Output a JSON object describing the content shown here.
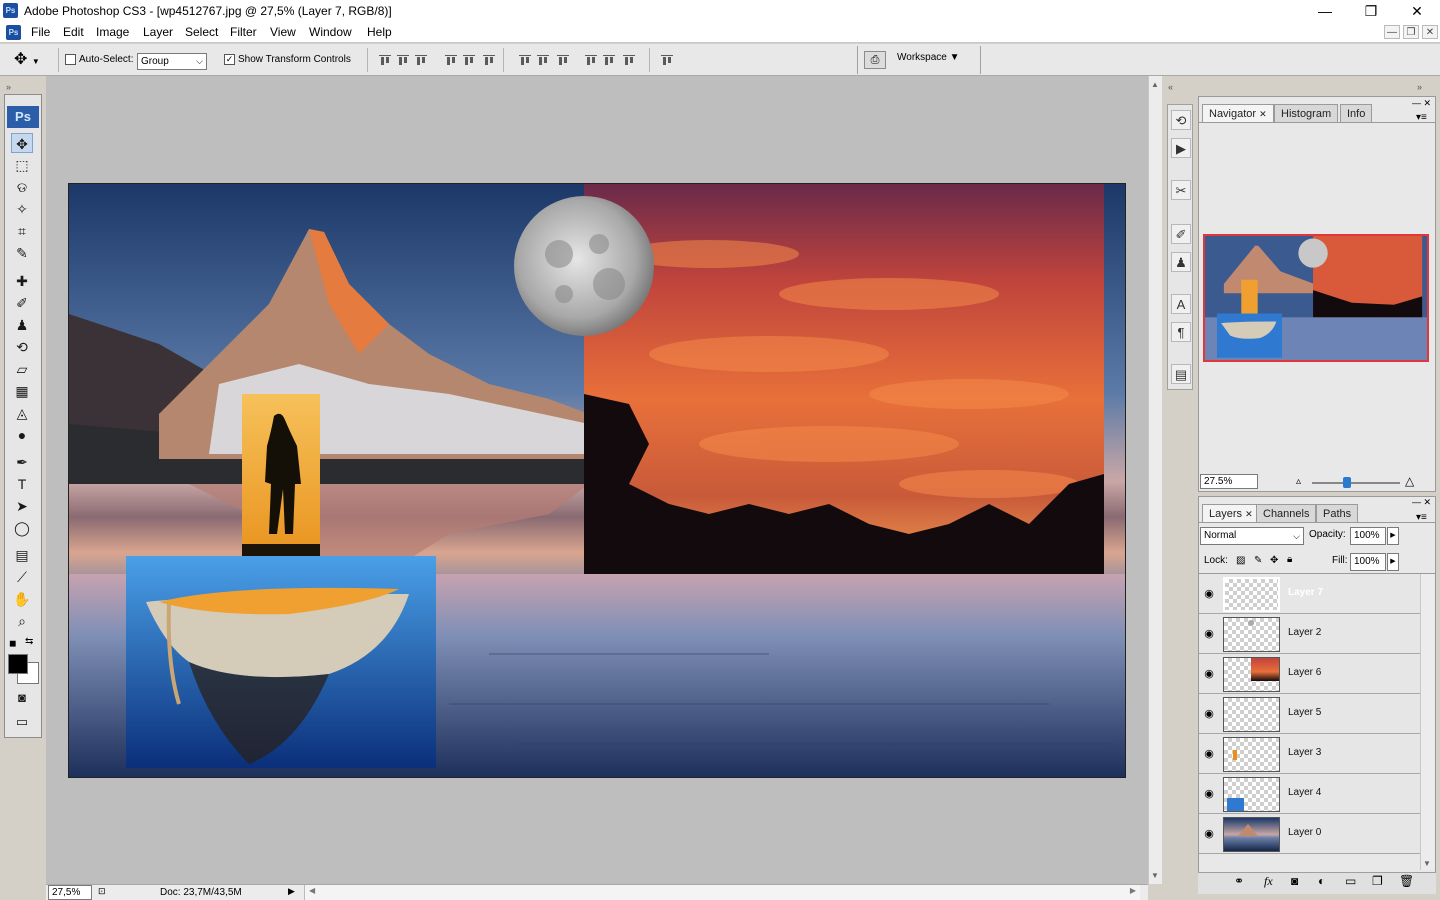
{
  "window": {
    "title": "Adobe Photoshop CS3 - [wp4512767.jpg @ 27,5% (Layer 7, RGB/8)]",
    "app_icon_text": "Ps",
    "minimize": "—",
    "restore": "❐",
    "close": "✕"
  },
  "menu": {
    "items": [
      "File",
      "Edit",
      "Image",
      "Layer",
      "Select",
      "Filter",
      "View",
      "Window",
      "Help"
    ],
    "doc_controls": [
      "—",
      "❐",
      "✕"
    ]
  },
  "options": {
    "auto_select_label": "Auto-Select:",
    "auto_select_checked": false,
    "group_value": "Group",
    "show_transform_label": "Show Transform Controls",
    "show_transform_checked": true,
    "workspace_label": "Workspace ▼"
  },
  "toolbox": {
    "logo": "Ps",
    "tools": [
      {
        "name": "move-tool",
        "glyph": "✥",
        "active": true
      },
      {
        "name": "marquee-tool",
        "glyph": "⬚"
      },
      {
        "name": "lasso-tool",
        "glyph": "ଡ"
      },
      {
        "name": "magic-wand-tool",
        "glyph": "✧"
      },
      {
        "name": "crop-tool",
        "glyph": "⌗"
      },
      {
        "name": "slice-tool",
        "glyph": "✎"
      },
      {
        "name": "healing-brush-tool",
        "glyph": "✚"
      },
      {
        "name": "brush-tool",
        "glyph": "✐"
      },
      {
        "name": "clone-stamp-tool",
        "glyph": "♟"
      },
      {
        "name": "history-brush-tool",
        "glyph": "⟲"
      },
      {
        "name": "eraser-tool",
        "glyph": "▱"
      },
      {
        "name": "gradient-tool",
        "glyph": "▦"
      },
      {
        "name": "blur-tool",
        "glyph": "◬"
      },
      {
        "name": "dodge-tool",
        "glyph": "●"
      },
      {
        "name": "pen-tool",
        "glyph": "✒"
      },
      {
        "name": "type-tool",
        "glyph": "T"
      },
      {
        "name": "path-selection-tool",
        "glyph": "➤"
      },
      {
        "name": "ellipse-tool",
        "glyph": "◯"
      },
      {
        "name": "notes-tool",
        "glyph": "▤"
      },
      {
        "name": "eyedropper-tool",
        "glyph": "⟋"
      },
      {
        "name": "hand-tool",
        "glyph": "✋"
      },
      {
        "name": "zoom-tool",
        "glyph": "⌕"
      }
    ],
    "foreground_color": "#000000",
    "background_color": "#ffffff"
  },
  "status": {
    "zoom": "27,5%",
    "doc": "Doc: 23,7M/43,5M"
  },
  "navigator": {
    "tabs": [
      "Navigator",
      "Histogram",
      "Info"
    ],
    "zoom_value": "27.5%"
  },
  "layers_panel": {
    "tabs": [
      "Layers",
      "Channels",
      "Paths"
    ],
    "blend_mode": "Normal",
    "opacity_label": "Opacity:",
    "opacity_value": "100%",
    "lock_label": "Lock:",
    "fill_label": "Fill:",
    "fill_value": "100%",
    "layers": [
      {
        "name": "Layer 7",
        "selected": true,
        "visible": true
      },
      {
        "name": "Layer 2",
        "selected": false,
        "visible": true
      },
      {
        "name": "Layer 6",
        "selected": false,
        "visible": true
      },
      {
        "name": "Layer 5",
        "selected": false,
        "visible": true
      },
      {
        "name": "Layer 3",
        "selected": false,
        "visible": true
      },
      {
        "name": "Layer 4",
        "selected": false,
        "visible": true
      },
      {
        "name": "Layer 0",
        "selected": false,
        "visible": true
      }
    ],
    "footer_icons": [
      "link-icon",
      "fx-icon",
      "mask-icon",
      "adjustment-icon",
      "folder-icon",
      "new-layer-icon",
      "trash-icon"
    ]
  },
  "colors": {
    "selection": "#0a64d6",
    "workspace_bg": "#bebebe",
    "navigator_frame": "#e0363c"
  }
}
